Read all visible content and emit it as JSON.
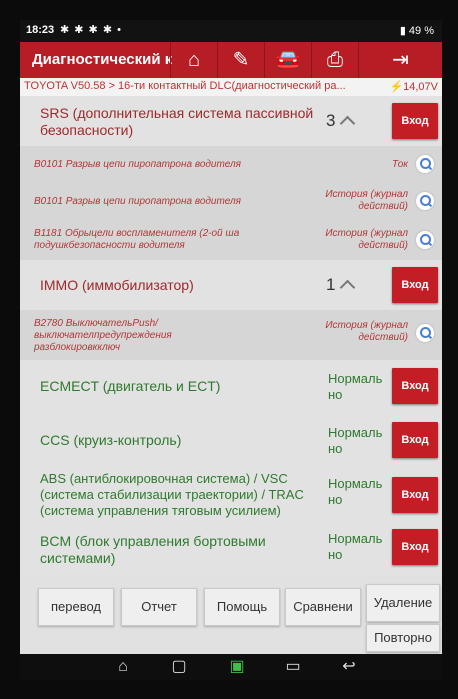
{
  "status_bar": {
    "time": "18:23",
    "notif_icons": "✱ ✱ ✱ ✱ •",
    "battery": "▮ 49 %"
  },
  "app_bar": {
    "title": "Диагностический к",
    "icons": [
      "home-icon",
      "report-edit-icon",
      "car-icon",
      "print-icon",
      "exit-icon"
    ],
    "glyphs": {
      "home": "⌂",
      "report": "✎",
      "car": "🚘",
      "print": "⎙",
      "exit": "⇥"
    }
  },
  "breadcrumb": {
    "path": "TOYOTA V50.58 > 16-ти контактный DLC(диагностический ра...",
    "voltage": "⚡14,07V"
  },
  "systems": [
    {
      "name": "SRS (дополнительная система пассивной безопасности)",
      "count": "3",
      "button": "Вход"
    },
    {
      "name": "IMMO (иммобилизатор)",
      "count": "1",
      "button": "Вход"
    },
    {
      "name": "ECMECT (двигатель и ECT)",
      "status": "Нормаль но",
      "button": "Вход"
    },
    {
      "name": "CCS (круиз-контроль)",
      "status": "Нормаль но",
      "button": "Вход"
    },
    {
      "name": "ABS (антиблокировочная система) / VSC (система стабилизации траектории) / TRAC (система управления тяговым усилием)",
      "status": "Нормаль но",
      "button": "Вход"
    },
    {
      "name": "BCM (блок управления бортовыми системами)",
      "status": "Нормаль но",
      "button": "Вход"
    }
  ],
  "dtcs": [
    {
      "desc": "B0101 Разрыв цепи пиропатрона водителя",
      "status": "Ток"
    },
    {
      "desc": "B0101 Разрыв цепи пиропатрона водителя",
      "status": "История (журнал действий)"
    },
    {
      "desc": "B1181 Обрыцели воспламенителя (2-ой ша подушкбезопасности водителя",
      "status": "История (журнал действий)"
    },
    {
      "desc": "B2780 ВыключательPush/ выключателпредупреждения разблокировкключ",
      "status": "История (журнал действий)"
    }
  ],
  "bottom_buttons": [
    "перевод",
    "Отчет",
    "Помощь",
    "Сравнени",
    "Удаление",
    "Повторно"
  ],
  "nav_bar": {
    "home": "⌂",
    "recents": "▢",
    "vci": "▣",
    "screenshot": "▭",
    "back": "↩"
  },
  "colors": {
    "accent_red": "#c31e25",
    "system_red_text": "#9c2a2a",
    "normal_green": "#2f7a2f",
    "dtc_text": "#b23636"
  }
}
